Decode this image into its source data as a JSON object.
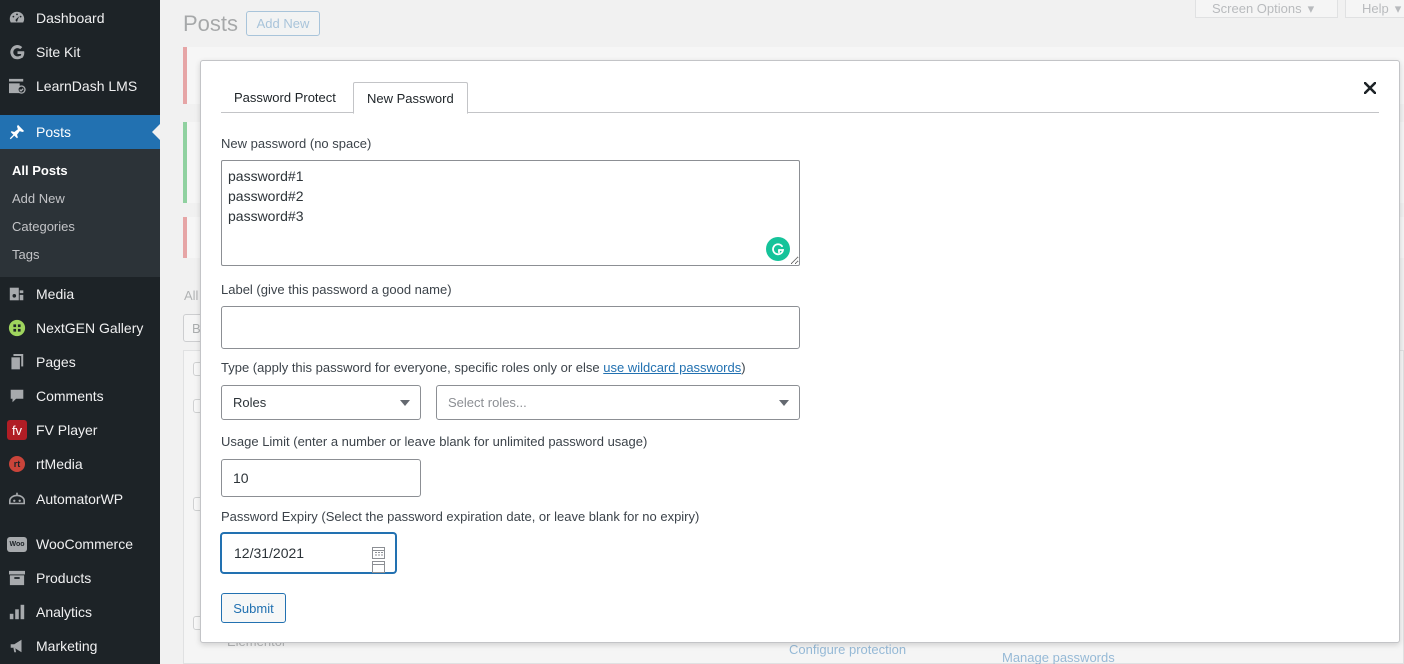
{
  "colors": {
    "sidebar_bg": "#1d2327",
    "accent": "#2271b1",
    "grammarly": "#15c39a"
  },
  "sidebar": {
    "items": [
      {
        "label": "Dashboard",
        "icon": "dashboard-icon"
      },
      {
        "label": "Site Kit",
        "icon": "google-g-icon"
      },
      {
        "label": "LearnDash LMS",
        "icon": "learndash-icon"
      },
      {
        "label": "Posts",
        "icon": "pushpin-icon",
        "active": true
      },
      {
        "label": "Media",
        "icon": "media-icon"
      },
      {
        "label": "NextGEN Gallery",
        "icon": "nextgen-icon"
      },
      {
        "label": "Pages",
        "icon": "pages-icon"
      },
      {
        "label": "Comments",
        "icon": "comment-icon"
      },
      {
        "label": "FV Player",
        "icon": "fv-icon"
      },
      {
        "label": "rtMedia",
        "icon": "rt-icon"
      },
      {
        "label": "AutomatorWP",
        "icon": "automator-icon"
      },
      {
        "label": "WooCommerce",
        "icon": "woo-icon"
      },
      {
        "label": "Products",
        "icon": "archive-icon"
      },
      {
        "label": "Analytics",
        "icon": "bar-chart-icon"
      },
      {
        "label": "Marketing",
        "icon": "megaphone-icon"
      }
    ],
    "submenu": [
      "All Posts",
      "Add New",
      "Categories",
      "Tags"
    ],
    "fv_icon_text": "fv",
    "rt_icon_text": "rt",
    "woo_icon_text": "Woo"
  },
  "background": {
    "page_title": "Posts",
    "add_new": "Add New",
    "screen_options": "Screen Options",
    "help": "Help",
    "filter_stub": "All",
    "bulk_stub": "B",
    "row_text": "Elementor",
    "link_configure": "Configure protection",
    "link_manage": "Manage passwords"
  },
  "modal": {
    "tabs": [
      "Password Protect",
      "New Password"
    ],
    "active_tab": 1,
    "new_password_label": "New password (no space)",
    "passwords_value": "password#1\npassword#2\npassword#3",
    "label_field_label": "Label (give this password a good name)",
    "label_value": "",
    "type_label_prefix": "Type (apply this password for everyone, specific roles only or else ",
    "type_label_link": "use wildcard passwords",
    "type_label_suffix": ")",
    "type_select": "Roles",
    "roles_placeholder": "Select roles...",
    "usage_label": "Usage Limit (enter a number or leave blank for unlimited password usage)",
    "usage_value": "10",
    "expiry_label": "Password Expiry (Select the password expiration date, or leave blank for no expiry)",
    "expiry_value": "12/31/2021",
    "submit_label": "Submit"
  }
}
